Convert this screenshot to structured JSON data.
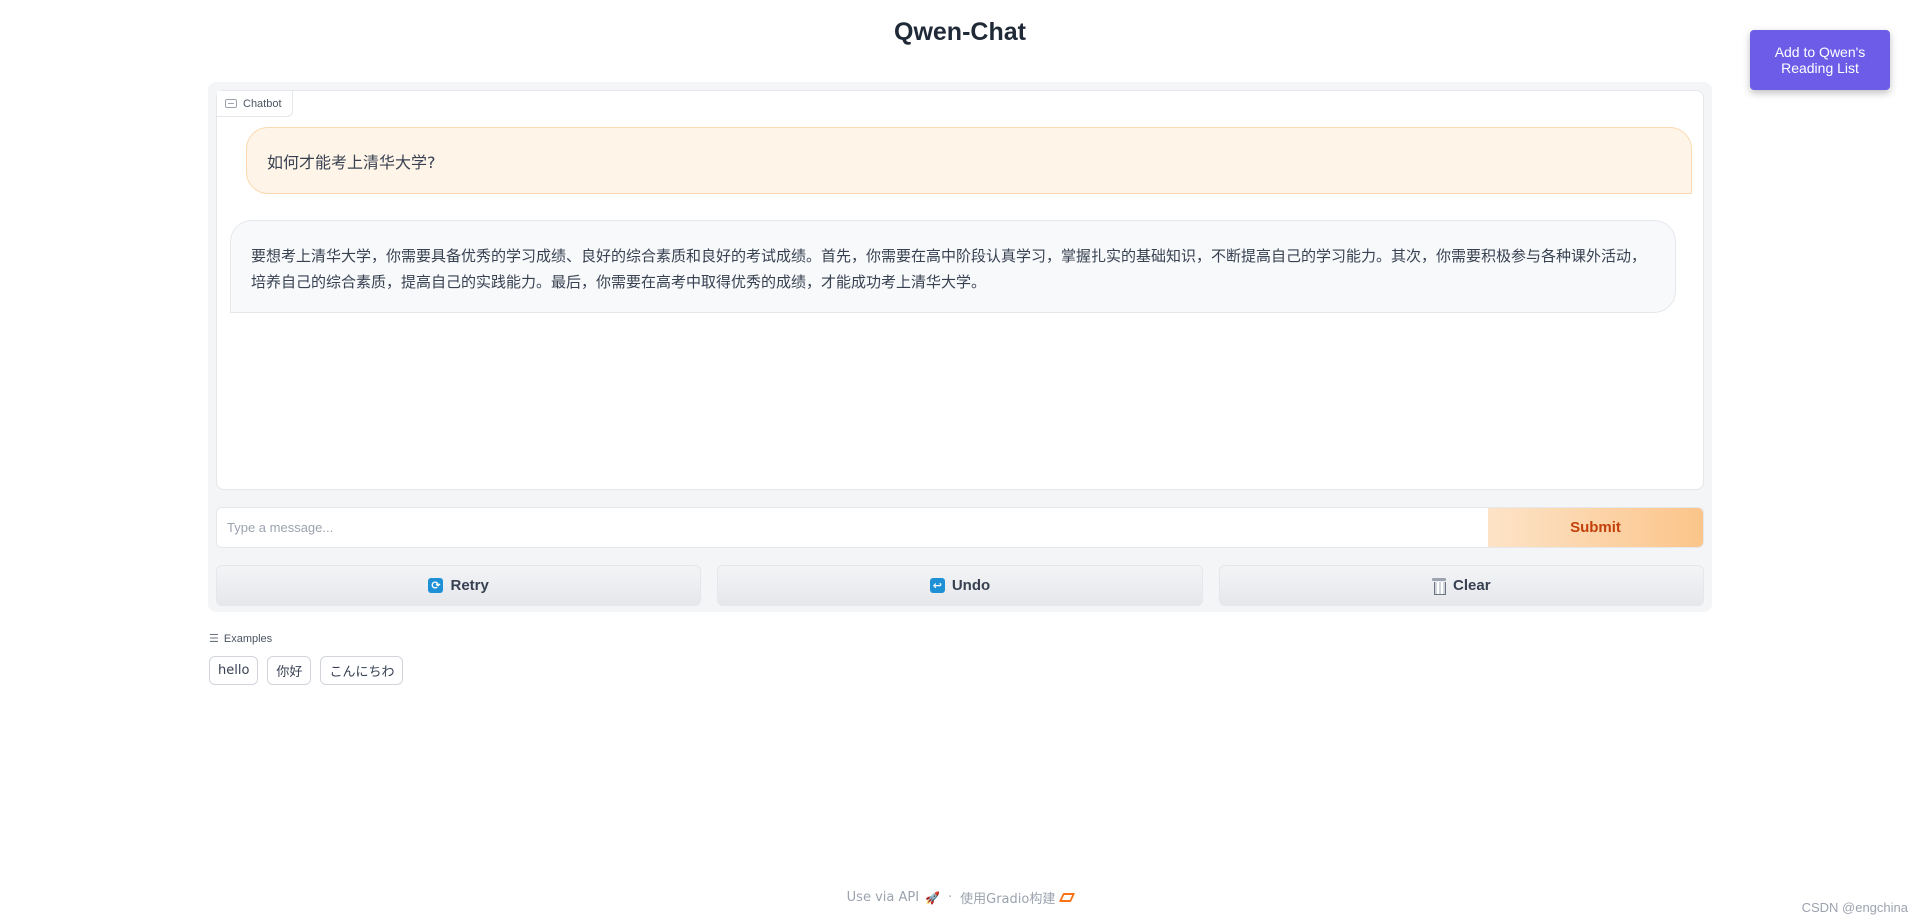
{
  "header": {
    "title": "Qwen-Chat"
  },
  "reading_list_button": {
    "label": "Add to Qwen's Reading List",
    "color": "#6c5ce7"
  },
  "chatbot": {
    "label": "Chatbot",
    "messages": [
      {
        "role": "user",
        "text": "如何才能考上清华大学?"
      },
      {
        "role": "bot",
        "text": "要想考上清华大学，你需要具备优秀的学习成绩、良好的综合素质和良好的考试成绩。首先，你需要在高中阶段认真学习，掌握扎实的基础知识，不断提高自己的学习能力。其次，你需要积极参与各种课外活动，培养自己的综合素质，提高自己的实践能力。最后，你需要在高考中取得优秀的成绩，才能成功考上清华大学。"
      }
    ]
  },
  "input": {
    "placeholder": "Type a message...",
    "value": ""
  },
  "submit": {
    "label": "Submit",
    "color": "#c2410c"
  },
  "actions": {
    "retry": {
      "label": "Retry",
      "icon": "refresh-icon"
    },
    "undo": {
      "label": "Undo",
      "icon": "undo-icon"
    },
    "clear": {
      "label": "Clear",
      "icon": "trash-icon"
    }
  },
  "examples": {
    "label": "Examples",
    "items": [
      "hello",
      "你好",
      "こんにちわ"
    ]
  },
  "footer": {
    "api_link": "Use via API",
    "separator": "·",
    "built_with": "使用Gradio构建"
  },
  "watermark": "CSDN @engchina"
}
